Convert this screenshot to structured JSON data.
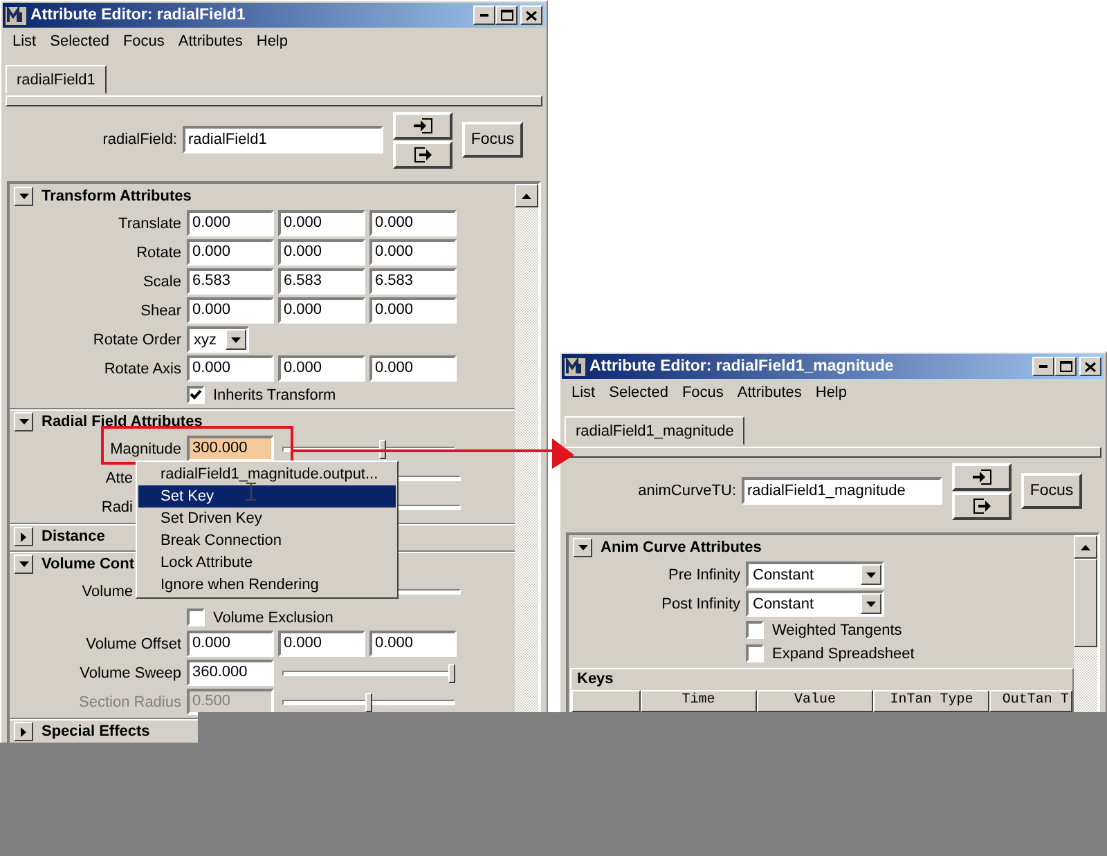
{
  "windows": [
    {
      "title": "Attribute Editor: radialField1",
      "menu": [
        "List",
        "Selected",
        "Focus",
        "Attributes",
        "Help"
      ],
      "tabs": [
        {
          "label": "radialField1",
          "selected": true
        }
      ],
      "node": {
        "label": "radialField:",
        "value": "radialField1"
      },
      "focus_button": "Focus",
      "sections": [
        {
          "title": "Transform Attributes",
          "expanded": true,
          "rows": [
            {
              "kind": "vector",
              "label": "Translate",
              "values": [
                "0.000",
                "0.000",
                "0.000"
              ]
            },
            {
              "kind": "vector",
              "label": "Rotate",
              "values": [
                "0.000",
                "0.000",
                "0.000"
              ]
            },
            {
              "kind": "vector",
              "label": "Scale",
              "values": [
                "6.583",
                "6.583",
                "6.583"
              ]
            },
            {
              "kind": "vector",
              "label": "Shear",
              "values": [
                "0.000",
                "0.000",
                "0.000"
              ]
            },
            {
              "kind": "dropdown",
              "label": "Rotate Order",
              "value": "xyz"
            },
            {
              "kind": "vector",
              "label": "Rotate Axis",
              "values": [
                "0.000",
                "0.000",
                "0.000"
              ]
            },
            {
              "kind": "checkbox",
              "label": "Inherits Transform",
              "checked": true
            }
          ]
        },
        {
          "title": "Radial Field Attributes",
          "expanded": true,
          "rows": [
            {
              "kind": "slider",
              "label": "Magnitude",
              "value": "300.000",
              "connected": true,
              "disabled": false,
              "level": 0.58
            },
            {
              "kind": "covered",
              "label": "Atte"
            },
            {
              "kind": "covered",
              "label": "Radi"
            }
          ]
        },
        {
          "title": "Distance",
          "expanded": false
        },
        {
          "title": "Volume Cont",
          "expanded": true,
          "rows": [
            {
              "kind": "covered",
              "label": "Volume"
            },
            {
              "kind": "checkbox",
              "label": "Volume Exclusion",
              "checked": false
            },
            {
              "kind": "vector",
              "label": "Volume Offset",
              "values": [
                "0.000",
                "0.000",
                "0.000"
              ]
            },
            {
              "kind": "slider",
              "label": "Volume Sweep",
              "value": "360.000",
              "connected": false,
              "disabled": false,
              "level": 1
            },
            {
              "kind": "slider",
              "label": "Section Radius",
              "value": "0.500",
              "connected": false,
              "disabled": true,
              "level": 0.5
            }
          ]
        },
        {
          "title": "Special Effects",
          "expanded": false
        }
      ]
    },
    {
      "title": "Attribute Editor: radialField1_magnitude",
      "menu": [
        "List",
        "Selected",
        "Focus",
        "Attributes",
        "Help"
      ],
      "tabs": [
        {
          "label": "radialField1_magnitude",
          "selected": true
        }
      ],
      "node": {
        "label": "animCurveTU:",
        "value": "radialField1_magnitude"
      },
      "focus_button": "Focus",
      "sections": [
        {
          "title": "Anim Curve Attributes",
          "expanded": true,
          "rows": [
            {
              "kind": "dropdown",
              "label": "Pre Infinity",
              "value": "Constant"
            },
            {
              "kind": "dropdown",
              "label": "Post Infinity",
              "value": "Constant"
            },
            {
              "kind": "checkbox",
              "label": "Weighted Tangents",
              "checked": false
            },
            {
              "kind": "checkbox",
              "label": "Expand Spreadsheet",
              "checked": false
            },
            {
              "kind": "table",
              "title": "Keys",
              "columns": [
                "Time",
                "Value",
                "InTan Type",
                "OutTan T"
              ]
            }
          ]
        }
      ]
    }
  ],
  "context_menu": {
    "items": [
      {
        "label": "radialField1_magnitude.output...",
        "selected": false
      },
      {
        "label": "Set Key",
        "selected": true
      },
      {
        "label": "Set Driven Key",
        "selected": false
      },
      {
        "label": "Break Connection",
        "selected": false
      },
      {
        "label": "Lock Attribute",
        "selected": false
      },
      {
        "label": "Ignore when Rendering",
        "selected": false
      }
    ]
  }
}
